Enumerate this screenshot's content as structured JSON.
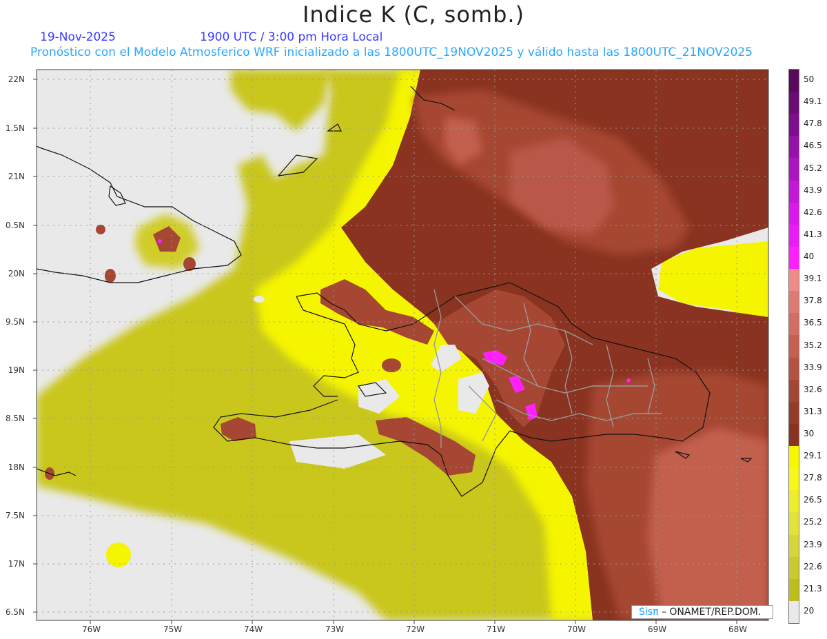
{
  "title": "Indice K (C, somb.)",
  "date": "19-Nov-2025",
  "valid_time": "1900 UTC / 3:00 pm Hora Local",
  "description": "Pronóstico con el Modelo Atmosferico WRF inicializado a las 1800UTC_19NOV2025 y válido hasta las  1800UTC_21NOV2025",
  "credit": {
    "brand": "Sisπ",
    "org": " – ONAMET/REP.DOM."
  },
  "lat_labels": [
    "22N",
    "1.5N",
    "21N",
    "0.5N",
    "20N",
    "9.5N",
    "19N",
    "8.5N",
    "18N",
    "7.5N",
    "17N",
    "6.5N"
  ],
  "lon_labels": [
    "76W",
    "75W",
    "74W",
    "73W",
    "72W",
    "71W",
    "70W",
    "69W",
    "68W"
  ],
  "colorbar": {
    "labels": [
      "50",
      "49.1",
      "47.8",
      "46.5",
      "45.2",
      "43.9",
      "42.6",
      "41.3",
      "40",
      "39.1",
      "37.8",
      "36.5",
      "35.2",
      "33.9",
      "32.6",
      "31.3",
      "30",
      "29.1",
      "27.8",
      "26.5",
      "25.2",
      "23.9",
      "22.6",
      "21.3",
      "20"
    ],
    "colors": [
      "#5a0a5a",
      "#6b0c75",
      "#7e0e8e",
      "#9511a8",
      "#ad14c2",
      "#c417d8",
      "#d91aea",
      "#ea1cf5",
      "#ff1fff",
      "#f08b8b",
      "#de7a72",
      "#d36c62",
      "#c55f52",
      "#b55244",
      "#a44636",
      "#943b2a",
      "#8a3320",
      "#f7f701",
      "#f7f71a",
      "#eded2a",
      "#e2e23a",
      "#d6d63a",
      "#caca30",
      "#bdbd1e",
      "#e9e9e9"
    ]
  },
  "colors": {
    "ocean_gray": "#e9e9e9",
    "yellow_bright": "#f5f500",
    "yellow_olive": "#c9c61e",
    "brown_dark": "#8a3320",
    "brown_mid": "#a64733",
    "brown_light": "#c35e4e"
  }
}
